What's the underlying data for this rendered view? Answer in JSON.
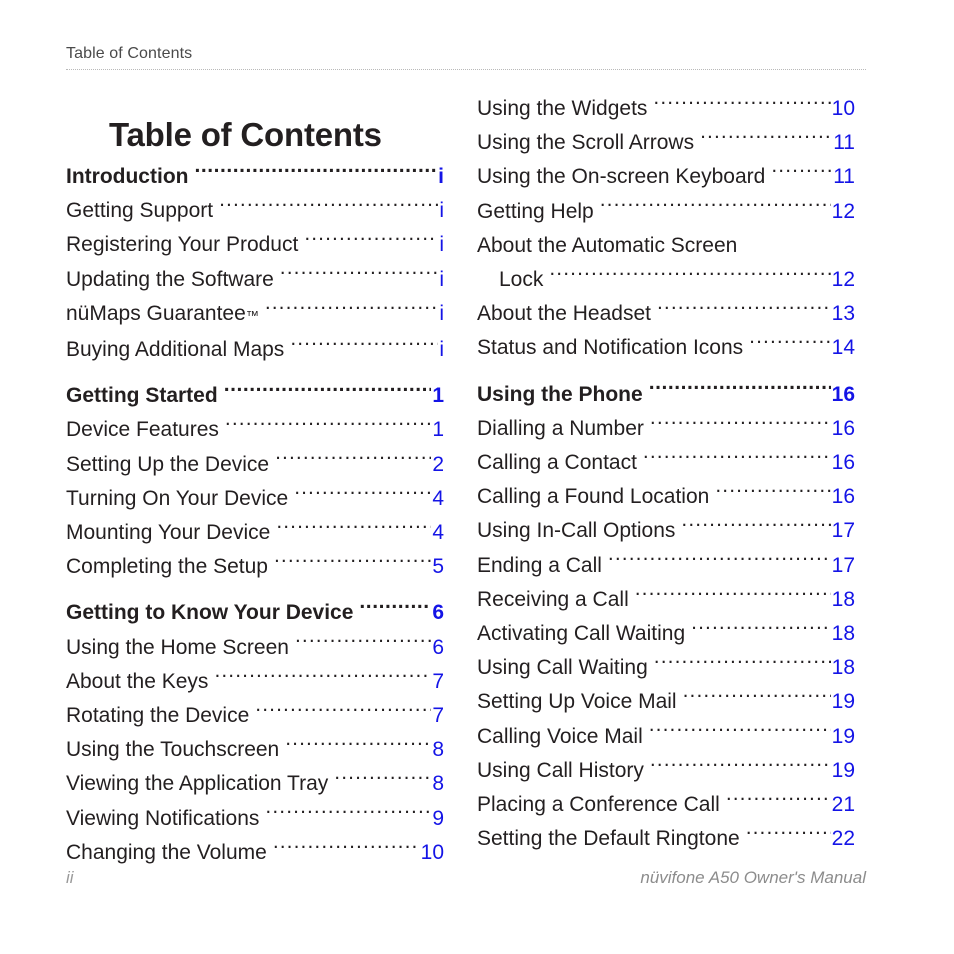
{
  "header": {
    "running_head": "Table of Contents"
  },
  "title": "Table of Contents",
  "footer": {
    "page_number": "ii",
    "manual_title": "nüvifone A50 Owner's Manual"
  },
  "colors": {
    "page_number": "#1414E6",
    "text": "#231f20",
    "footer_text": "#8c8c8c",
    "rule": "#b9b9b9"
  },
  "columns": {
    "left": [
      {
        "label": "Introduction",
        "page": "i",
        "level": "section"
      },
      {
        "label": "Getting Support",
        "page": "i",
        "level": "entry"
      },
      {
        "label": "Registering Your Product",
        "page": "i",
        "level": "entry"
      },
      {
        "label": "Updating the Software",
        "page": "i",
        "level": "entry"
      },
      {
        "label": "nüMaps Guarantee",
        "trademark": "™",
        "page": "i",
        "level": "entry"
      },
      {
        "label": "Buying Additional Maps",
        "page": "i",
        "level": "entry"
      },
      {
        "label": "Getting Started",
        "page": "1",
        "level": "section"
      },
      {
        "label": "Device Features",
        "page": "1",
        "level": "entry"
      },
      {
        "label": "Setting Up the Device",
        "page": "2",
        "level": "entry"
      },
      {
        "label": "Turning On Your Device",
        "page": "4",
        "level": "entry"
      },
      {
        "label": "Mounting Your Device",
        "page": "4",
        "level": "entry"
      },
      {
        "label": "Completing the Setup",
        "page": "5",
        "level": "entry"
      },
      {
        "label": "Getting to Know Your Device",
        "page": "6",
        "level": "section"
      },
      {
        "label": "Using the Home Screen",
        "page": "6",
        "level": "entry"
      },
      {
        "label": "About the Keys",
        "page": "7",
        "level": "entry"
      },
      {
        "label": "Rotating the Device",
        "page": "7",
        "level": "entry"
      },
      {
        "label": "Using the Touchscreen",
        "page": "8",
        "level": "entry"
      },
      {
        "label": "Viewing the Application Tray",
        "page": "8",
        "level": "entry"
      },
      {
        "label": "Viewing Notifications",
        "page": "9",
        "level": "entry"
      },
      {
        "label": "Changing the Volume",
        "page": "10",
        "level": "entry"
      }
    ],
    "right": [
      {
        "label": "Using the Widgets",
        "page": "10",
        "level": "entry"
      },
      {
        "label": "Using the Scroll Arrows",
        "page": "11",
        "level": "entry"
      },
      {
        "label": "Using the On-screen Keyboard",
        "page": "11",
        "level": "entry"
      },
      {
        "label": "Getting Help",
        "page": "12",
        "level": "entry"
      },
      {
        "label": "About the Automatic Screen",
        "page": "",
        "level": "wrap-head"
      },
      {
        "label": "Lock",
        "page": "12",
        "level": "cont"
      },
      {
        "label": "About the Headset",
        "page": "13",
        "level": "entry"
      },
      {
        "label": "Status and Notification Icons",
        "page": "14",
        "level": "entry"
      },
      {
        "label": "Using the Phone",
        "page": "16",
        "level": "section"
      },
      {
        "label": "Dialling a Number",
        "page": "16",
        "level": "entry"
      },
      {
        "label": "Calling a Contact",
        "page": "16",
        "level": "entry"
      },
      {
        "label": "Calling a Found Location",
        "page": "16",
        "level": "entry"
      },
      {
        "label": "Using In-Call Options",
        "page": "17",
        "level": "entry"
      },
      {
        "label": "Ending a Call",
        "page": "17",
        "level": "entry"
      },
      {
        "label": "Receiving a Call",
        "page": "18",
        "level": "entry"
      },
      {
        "label": "Activating Call Waiting",
        "page": "18",
        "level": "entry"
      },
      {
        "label": "Using Call Waiting",
        "page": "18",
        "level": "entry"
      },
      {
        "label": "Setting Up Voice Mail",
        "page": "19",
        "level": "entry"
      },
      {
        "label": "Calling Voice Mail",
        "page": "19",
        "level": "entry"
      },
      {
        "label": "Using Call History",
        "page": "19",
        "level": "entry"
      },
      {
        "label": "Placing a Conference Call",
        "page": "21",
        "level": "entry"
      },
      {
        "label": "Setting the Default Ringtone",
        "page": "22",
        "level": "entry"
      }
    ]
  }
}
